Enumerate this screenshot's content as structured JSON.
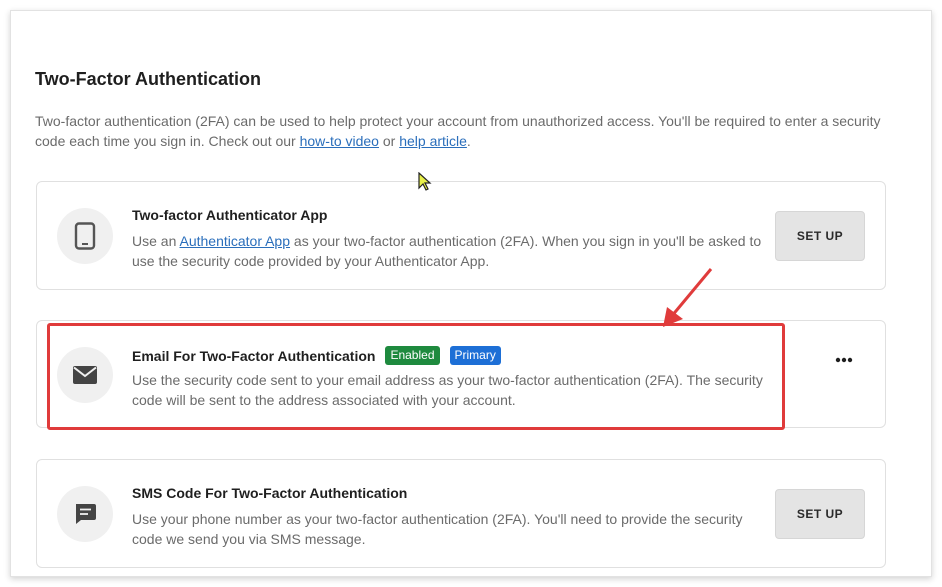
{
  "section": {
    "title": "Two-Factor Authentication",
    "description_prefix": "Two-factor authentication (2FA) can be used to help protect your account from unauthorized access. You'll be required to enter a security code each time you sign in. Check out our",
    "howto_link": "how-to video",
    "or_text": " or ",
    "help_link": "help article",
    "description_suffix": "."
  },
  "methods": [
    {
      "title": "Two-factor Authenticator App",
      "desc_prefix": "Use an ",
      "desc_link": "Authenticator App",
      "desc_suffix": " as your two-factor authentication (2FA). When you sign in you'll be asked to use the security code provided by your Authenticator App.",
      "action_label": "SET UP",
      "icon": "phone-icon"
    },
    {
      "title": "Email For Two-Factor Authentication",
      "badges": [
        "Enabled",
        "Primary"
      ],
      "desc": "Use the security code sent to your email address as your two-factor authentication (2FA). The security code will be sent to the address associated with your account.",
      "more_label": "•••",
      "icon": "envelope-icon"
    },
    {
      "title": "SMS Code For Two-Factor Authentication",
      "desc": "Use your phone number as your two-factor authentication (2FA). You'll need to provide the security code we send you via SMS message.",
      "action_label": "SET UP",
      "icon": "chat-icon"
    }
  ],
  "colors": {
    "link": "#2a6ebb",
    "enabled_badge": "#1e8a3e",
    "primary_badge": "#1d6fd6",
    "highlight": "#e03b3b",
    "button_bg": "#e4e4e4"
  }
}
